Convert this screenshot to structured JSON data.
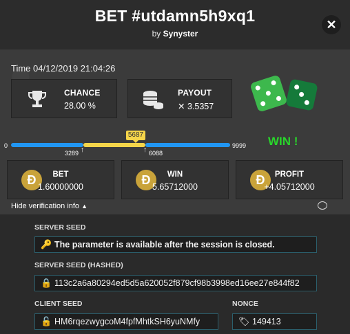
{
  "header": {
    "title": "BET #utdamn5h9xq1",
    "by_prefix": "by",
    "by_user": "Synyster",
    "close_glyph": "✕"
  },
  "summary": {
    "time_label": "Time 04/12/2019 21:04:26",
    "chance": {
      "label": "CHANCE",
      "value": "28.00 %"
    },
    "payout": {
      "label": "PAYOUT",
      "value": "✕ 3.5357"
    }
  },
  "range": {
    "min": "0",
    "max": "9999",
    "low": "3289",
    "high": "6088",
    "rolled": "5687",
    "result": "WIN !"
  },
  "results": {
    "bet": {
      "label": "BET",
      "value": "1.60000000"
    },
    "win": {
      "label": "WIN",
      "value": "5.65712000"
    },
    "profit": {
      "label": "PROFIT",
      "value": "+4.05712000"
    },
    "coin_glyph": "Ð"
  },
  "verification": {
    "toggle_label": "Hide verification info",
    "server_seed_label": "SERVER SEED",
    "server_seed_value": "The parameter is available after the session is closed.",
    "server_seed_hashed_label": "SERVER SEED (HASHED)",
    "server_seed_hashed_value": "113c2a6a80294ed5d5a620052f879cf98b3998ed16ee27e844f82",
    "client_seed_label": "CLIENT SEED",
    "client_seed_value": "HM6rqezwygcoM4fpfMhtkSH6yuNMfy",
    "nonce_label": "NONCE",
    "nonce_value": "149413"
  },
  "colors": {
    "accent_blue": "#2196f3",
    "accent_yellow": "#f5d54a",
    "win_green": "#29d42b",
    "coin_gold": "#c9a33a"
  }
}
